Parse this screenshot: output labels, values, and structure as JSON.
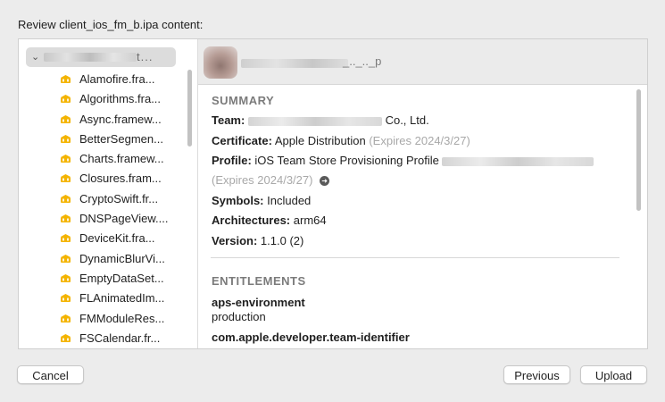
{
  "dialog": {
    "title": "Review client_ios_fm_b.ipa content:"
  },
  "sidebar": {
    "root_label": "t...",
    "items": [
      {
        "label": "Alamofire.fra...",
        "icon": "framework-icon"
      },
      {
        "label": "Algorithms.fra...",
        "icon": "framework-icon"
      },
      {
        "label": "Async.framew...",
        "icon": "framework-icon"
      },
      {
        "label": "BetterSegmen...",
        "icon": "framework-icon"
      },
      {
        "label": "Charts.framew...",
        "icon": "framework-icon"
      },
      {
        "label": "Closures.fram...",
        "icon": "framework-icon"
      },
      {
        "label": "CryptoSwift.fr...",
        "icon": "framework-icon"
      },
      {
        "label": "DNSPageView....",
        "icon": "framework-icon"
      },
      {
        "label": "DeviceKit.fra...",
        "icon": "framework-icon"
      },
      {
        "label": "DynamicBlurVi...",
        "icon": "framework-icon"
      },
      {
        "label": "EmptyDataSet...",
        "icon": "framework-icon"
      },
      {
        "label": "FLAnimatedIm...",
        "icon": "framework-icon"
      },
      {
        "label": "FMModuleRes...",
        "icon": "framework-icon"
      },
      {
        "label": "FSCalendar.fr...",
        "icon": "framework-icon"
      }
    ]
  },
  "detail": {
    "app_name_tail": "_.._.._p",
    "summary": {
      "title": "SUMMARY",
      "team_label": "Team:",
      "team_value": "Co., Ltd.",
      "certificate_label": "Certificate:",
      "certificate_value": "Apple Distribution",
      "certificate_expiry": "(Expires 2024/3/27)",
      "profile_label": "Profile:",
      "profile_value": "iOS Team Store Provisioning Profile",
      "profile_expiry": "(Expires 2024/3/27)",
      "symbols_label": "Symbols:",
      "symbols_value": "Included",
      "architectures_label": "Architectures:",
      "architectures_value": "arm64",
      "version_label": "Version:",
      "version_value": "1.1.0 (2)"
    },
    "entitlements": {
      "title": "ENTITLEMENTS",
      "items": [
        {
          "key": "aps-environment",
          "value": "production"
        },
        {
          "key": "com.apple.developer.team-identifier",
          "value": ""
        }
      ]
    }
  },
  "buttons": {
    "cancel": "Cancel",
    "previous": "Previous",
    "upload": "Upload"
  },
  "colors": {
    "framework_icon": "#f4b400",
    "selection": "#dcdcdc"
  }
}
